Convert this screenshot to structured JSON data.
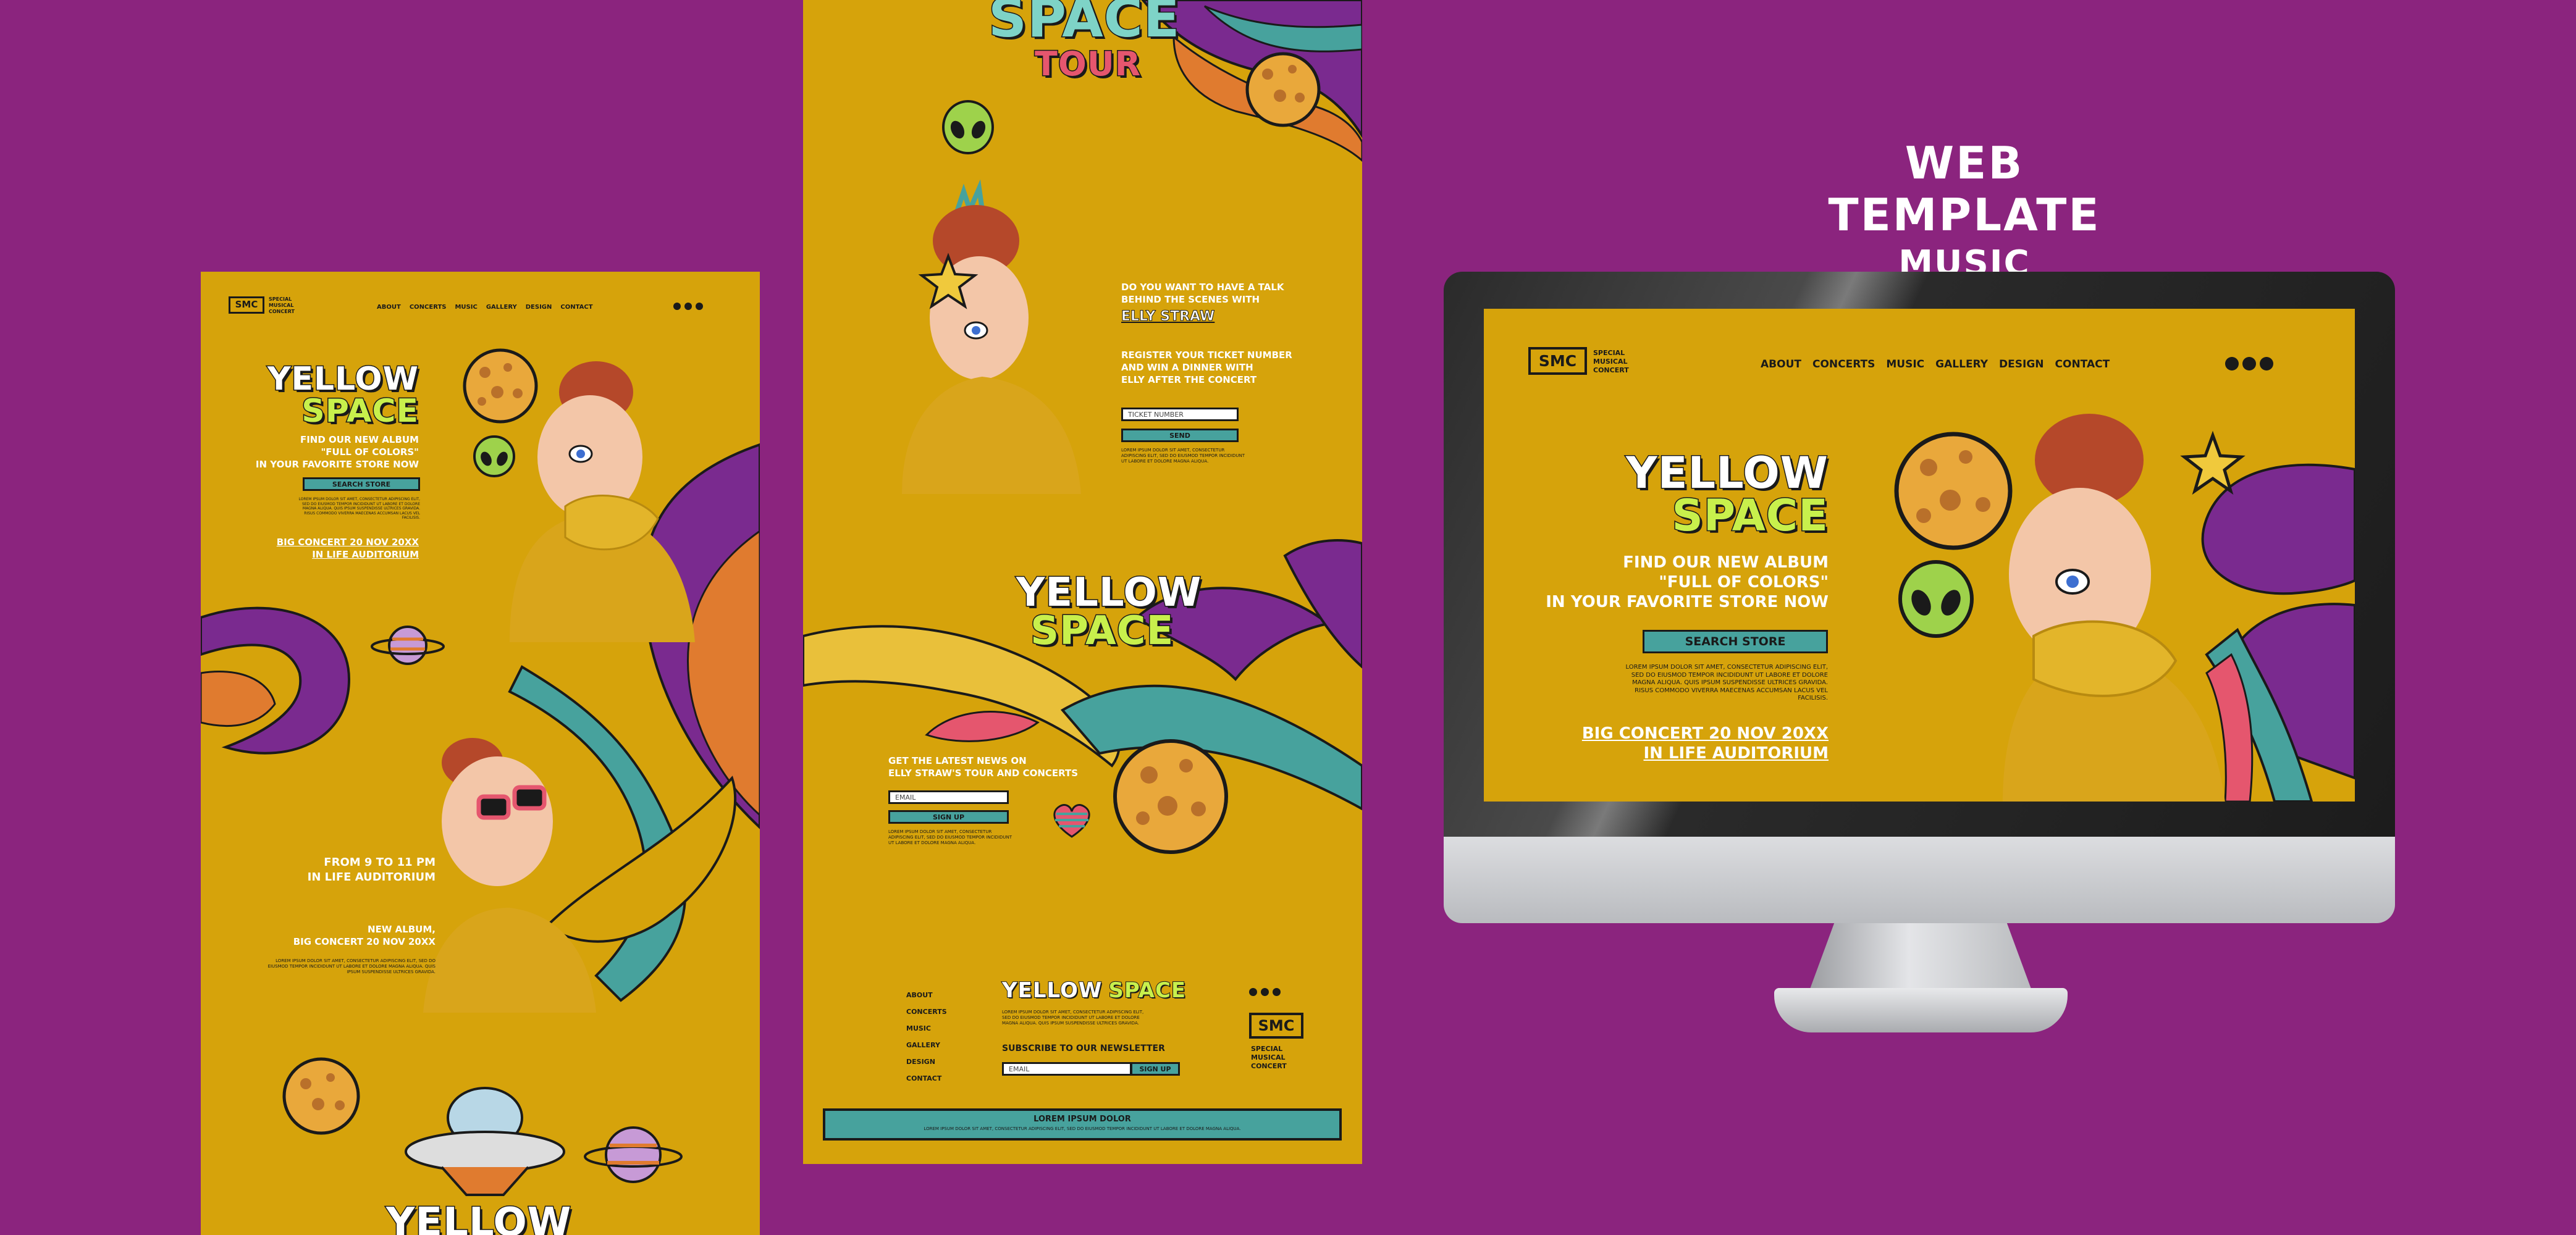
{
  "brand": {
    "logo": "SMC",
    "tagline": "SPECIAL MUSICAL CONCERT",
    "tagline_lines": [
      "SPECIAL",
      "MUSICAL",
      "CONCERT"
    ]
  },
  "nav": {
    "items": [
      "ABOUT",
      "CONCERTS",
      "MUSIC",
      "GALLERY",
      "DESIGN",
      "CONTACT"
    ]
  },
  "heading": {
    "title": "WEB TEMPLATE",
    "subtitle": "MUSIC"
  },
  "hero": {
    "title_line1": "YELLOW",
    "title_line2": "SPACE",
    "subtitle_lines": [
      "FIND OUR NEW ALBUM",
      "\"FULL OF COLORS\"",
      "IN YOUR FAVORITE STORE NOW"
    ],
    "cta": "SEARCH STORE",
    "body": "LOREM IPSUM DOLOR SIT AMET, CONSECTETUR ADIPISCING ELIT, SED DO EIUSMOD TEMPOR INCIDIDUNT UT LABORE ET DOLORE MAGNA ALIQUA. QUIS IPSUM SUSPENDISSE ULTRICES GRAVIDA. RISUS COMMODO VIVERRA MAECENAS ACCUMSAN LACUS VEL FACILISIS.",
    "concert_lines": [
      "BIG CONCERT 20 NOV 20XX",
      "IN LIFE AUDITORIUM"
    ]
  },
  "left": {
    "time_lines": [
      "FROM 9 TO 11 PM",
      "IN LIFE AUDITORIUM"
    ],
    "album_lines": [
      "NEW ALBUM,",
      "BIG CONCERT 20 NOV 20XX"
    ],
    "album_body": "LOREM IPSUM DOLOR SIT AMET, CONSECTETUR ADIPISCING ELIT, SED DO EIUSMOD TEMPOR INCIDIDUNT UT LABORE ET DOLORE MAGNA ALIQUA. QUIS IPSUM SUSPENDISSE ULTRICES GRAVIDA.",
    "bottom_title": "YELLOW"
  },
  "middle": {
    "tour_line1": "SPACE",
    "tour_line2": "TOUR",
    "talk_lines": [
      "DO YOU WANT TO HAVE A TALK",
      "BEHIND THE SCENES WITH"
    ],
    "talk_name": "ELLY STRAW",
    "register_lines": [
      "REGISTER YOUR TICKET NUMBER",
      "AND WIN A DINNER WITH",
      "ELLY AFTER THE CONCERT"
    ],
    "ticket_placeholder": "TICKET NUMBER",
    "send": "SEND",
    "register_body": "LOREM IPSUM DOLOR SIT AMET, CONSECTETUR ADIPISCING ELIT, SED DO EIUSMOD TEMPOR INCIDIDUNT UT LABORE ET DOLORE MAGNA ALIQUA.",
    "news_lines": [
      "GET THE LATEST NEWS ON",
      "ELLY STRAW'S TOUR AND CONCERTS"
    ],
    "email_placeholder": "EMAIL",
    "signup": "SIGN UP",
    "news_body": "LOREM IPSUM DOLOR SIT AMET, CONSECTETUR ADIPISCING ELIT, SED DO EIUSMOD TEMPOR INCIDIDUNT UT LABORE ET DOLORE MAGNA ALIQUA.",
    "footer_title_a": "YELLOW",
    "footer_title_b": "SPACE",
    "footer_body": "LOREM IPSUM DOLOR SIT AMET, CONSECTETUR ADIPISCING ELIT, SED DO EIUSMOD TEMPOR INCIDIDUNT UT LABORE ET DOLORE MAGNA ALIQUA. QUIS IPSUM SUSPENDISSE ULTRICES GRAVIDA.",
    "newsletter": "SUBSCRIBE TO OUR NEWSLETTER",
    "footer_email": "EMAIL",
    "footer_signup": "SIGN UP",
    "bar_title": "LOREM IPSUM DOLOR",
    "bar_body": "LOREM IPSUM DOLOR SIT AMET, CONSECTETUR ADIPISCING ELIT, SED DO EIUSMOD TEMPOR INCIDIDUNT UT LABORE ET DOLORE MAGNA ALIQUA."
  },
  "icons": [
    "facebook-icon",
    "instagram-icon",
    "youtube-icon",
    "alien-icon",
    "planet-icon",
    "ufo-icon",
    "star-icon",
    "heart-icon"
  ],
  "colors": {
    "background": "#8b247e",
    "panel": "#d6a30b",
    "accent_teal": "#47a29d",
    "accent_purple": "#7a2a8f",
    "text_green": "#c8f04c"
  }
}
